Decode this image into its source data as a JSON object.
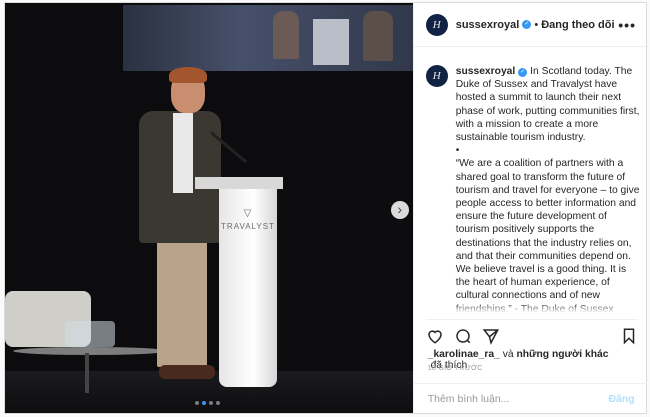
{
  "header": {
    "username": "sussexroyal",
    "avatar_text": "H",
    "separator": "•",
    "follow_status": "Đang theo dõi",
    "more": "•••"
  },
  "caption": {
    "username": "sussexroyal",
    "avatar_text": "H",
    "paragraphs": [
      "In Scotland today. The Duke of Sussex and Travalyst have hosted a summit to launch their next phase of work, putting communities first, with a mission to create a more sustainable tourism industry.",
      "•",
      "“We are a coalition of partners with a shared goal to transform the future of tourism and travel for everyone – to give people access to better information and ensure the future development of tourism positively supports the destinations that the industry relies on, and that their communities depend on.",
      "We believe travel is a good thing. It is the heart of human experience, of cultural connections and of new friendships.” - The Duke of Sussex"
    ]
  },
  "media": {
    "lectern_brand": "TRAVALYST",
    "next_arrow": "›",
    "slide_count": 4,
    "active_slide": 1
  },
  "likes": {
    "user": "_karolinae_ra_",
    "connector": " và ",
    "others": "những người khác",
    "suffix": " đã thích"
  },
  "timestamp": "10 GIỜ TRƯỚC",
  "comment": {
    "placeholder": "Thêm bình luận...",
    "post_label": "Đăng"
  },
  "colors": {
    "accent": "#3897f0",
    "post_disabled": "#b2dffc",
    "avatar_bg": "#122244"
  }
}
